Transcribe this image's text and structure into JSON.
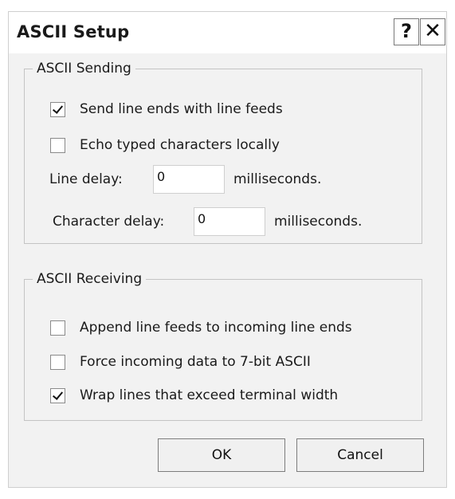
{
  "window": {
    "title": "ASCII Setup",
    "help_glyph": "?",
    "close_glyph": "✕"
  },
  "sending": {
    "legend": "ASCII Sending",
    "send_line_ends": {
      "label": "Send line ends with line feeds",
      "checked": true
    },
    "echo_typed": {
      "label": "Echo typed characters locally",
      "checked": false
    },
    "line_delay": {
      "label": "Line delay:",
      "value": "0",
      "unit": "milliseconds."
    },
    "character_delay": {
      "label": "Character delay:",
      "value": "0",
      "unit": "milliseconds."
    }
  },
  "receiving": {
    "legend": "ASCII Receiving",
    "append_line_feeds": {
      "label": "Append line feeds to incoming line ends",
      "checked": false
    },
    "force_7bit": {
      "label": "Force incoming data to 7-bit ASCII",
      "checked": false
    },
    "wrap_lines": {
      "label": "Wrap lines that exceed terminal width",
      "checked": true
    }
  },
  "buttons": {
    "ok": "OK",
    "cancel": "Cancel"
  }
}
